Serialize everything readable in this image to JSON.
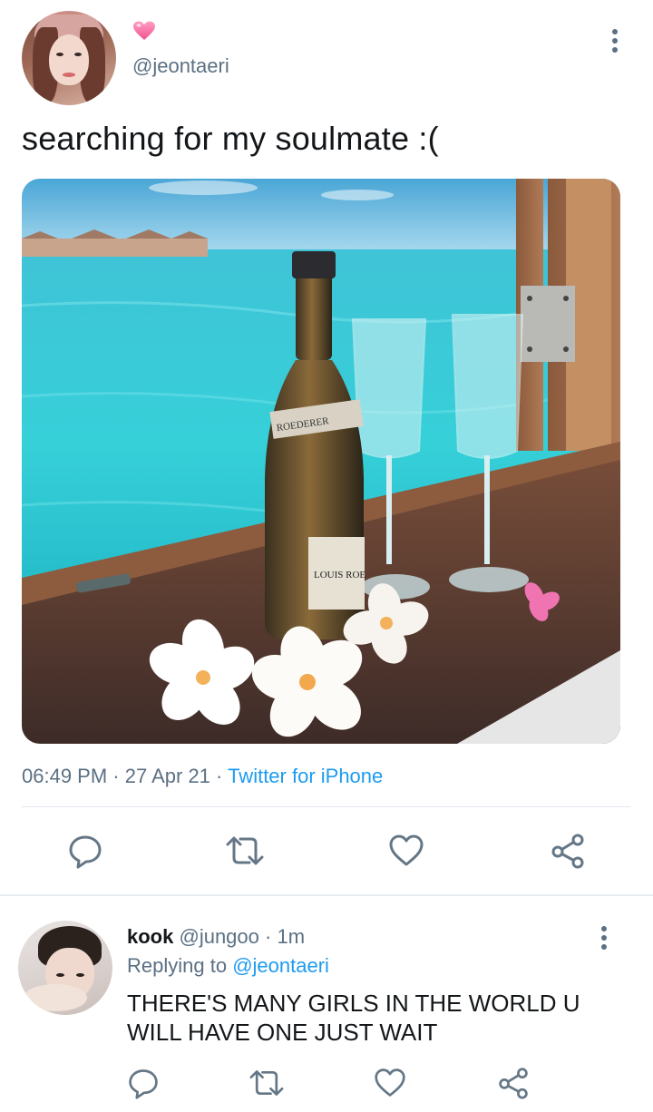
{
  "tweet": {
    "handle": "@jeontaeri",
    "text": "searching for my soulmate :(",
    "time": "06:49 PM",
    "separator": " · ",
    "date": "27 Apr 21",
    "source": "Twitter for iPhone",
    "photo": {
      "bottle_label_top": "ROEDERER",
      "bottle_label_main": "LOUIS ROE"
    }
  },
  "reply": {
    "name": "kook",
    "handle": "@jungoo",
    "dot": " · ",
    "time": "1m",
    "replying_prefix": "Replying to ",
    "replying_to": "@jeontaeri",
    "text": "THERE'S MANY GIRLS IN THE WORLD U WILL HAVE ONE JUST WAIT"
  },
  "icons": {
    "header": [
      "pink-heart-icon",
      "more-icon"
    ],
    "actions": [
      "reply-icon",
      "retweet-icon",
      "like-icon",
      "share-icon"
    ]
  },
  "colors": {
    "text": "#14171a",
    "secondary": "#5b7083",
    "link": "#1d9bf0",
    "icon": "#657786",
    "divider": "#e1e8ed"
  }
}
